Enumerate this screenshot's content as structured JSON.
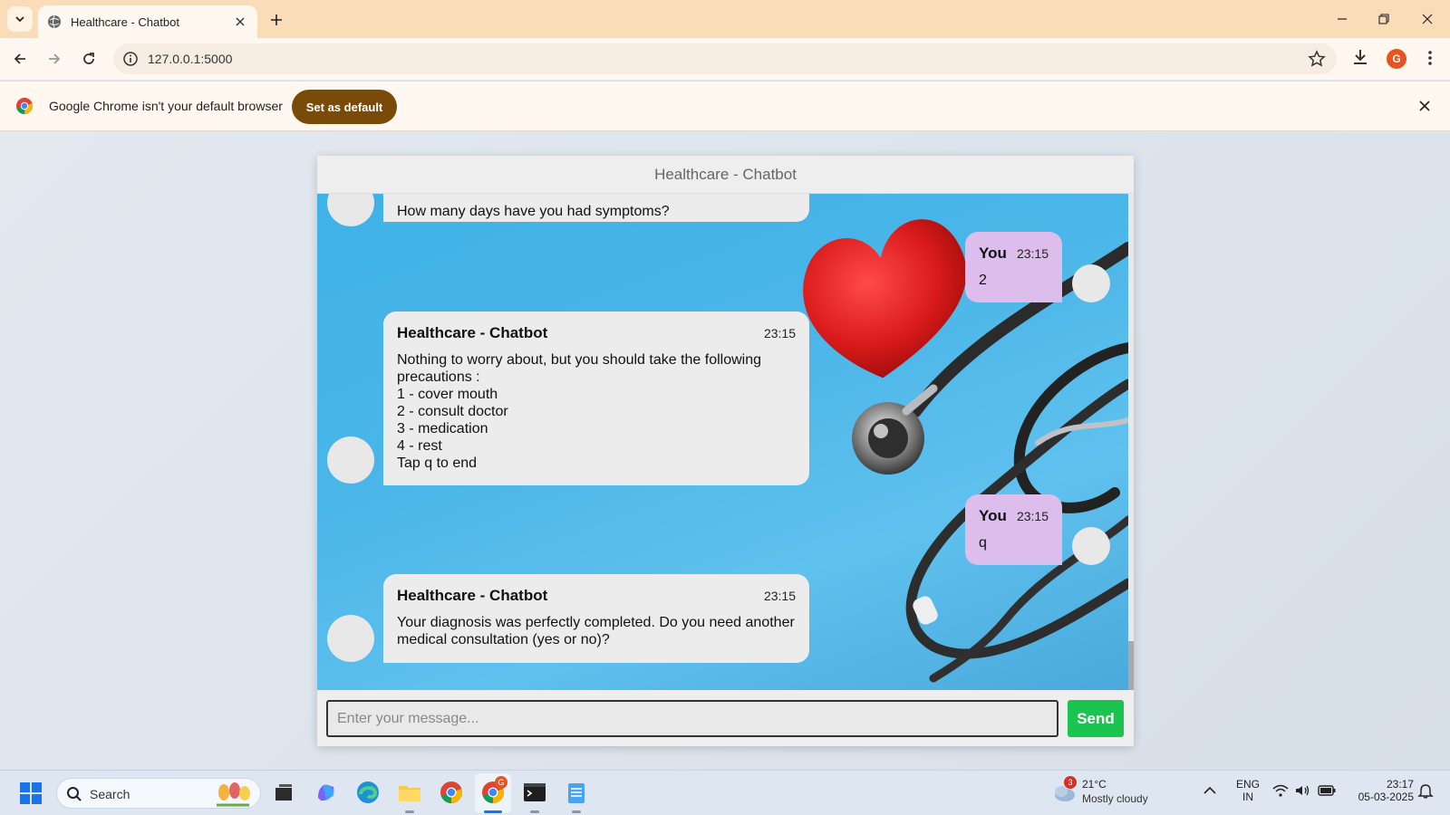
{
  "browser": {
    "tab_title": "Healthcare - Chatbot",
    "url": "127.0.0.1:5000",
    "profile_initial": "G",
    "infobar_message": "Google Chrome isn't your default browser",
    "set_default_label": "Set as default"
  },
  "chat": {
    "header_title": "Healthcare - Chatbot",
    "partial_message": "How many days have you had symptoms?",
    "messages": [
      {
        "sender": "You",
        "time": "23:15",
        "text": "2"
      },
      {
        "sender": "Healthcare - Chatbot",
        "time": "23:15",
        "text": "Nothing to worry about, but you should take the following precautions :\n1 - cover mouth\n2 - consult doctor\n3 - medication\n4 - rest\nTap q to end"
      },
      {
        "sender": "You",
        "time": "23:15",
        "text": "q"
      },
      {
        "sender": "Healthcare - Chatbot",
        "time": "23:15",
        "text": "Your diagnosis was perfectly completed. Do you need another medical consultation (yes or no)?"
      }
    ],
    "input_placeholder": "Enter your message...",
    "send_label": "Send"
  },
  "taskbar": {
    "search_label": "Search",
    "weather_badge": "3",
    "weather_temp": "21°C",
    "weather_condition": "Mostly cloudy",
    "language": "ENG",
    "region": "IN",
    "time": "23:17",
    "date": "05-03-2025",
    "chrome_badge": "G"
  },
  "colors": {
    "title_bar": "#fbdcb8",
    "set_default_button": "#7a4a08",
    "send_button": "#1bc44f",
    "user_bubble": "#dcbdeb",
    "bot_bubble": "#ececec"
  }
}
